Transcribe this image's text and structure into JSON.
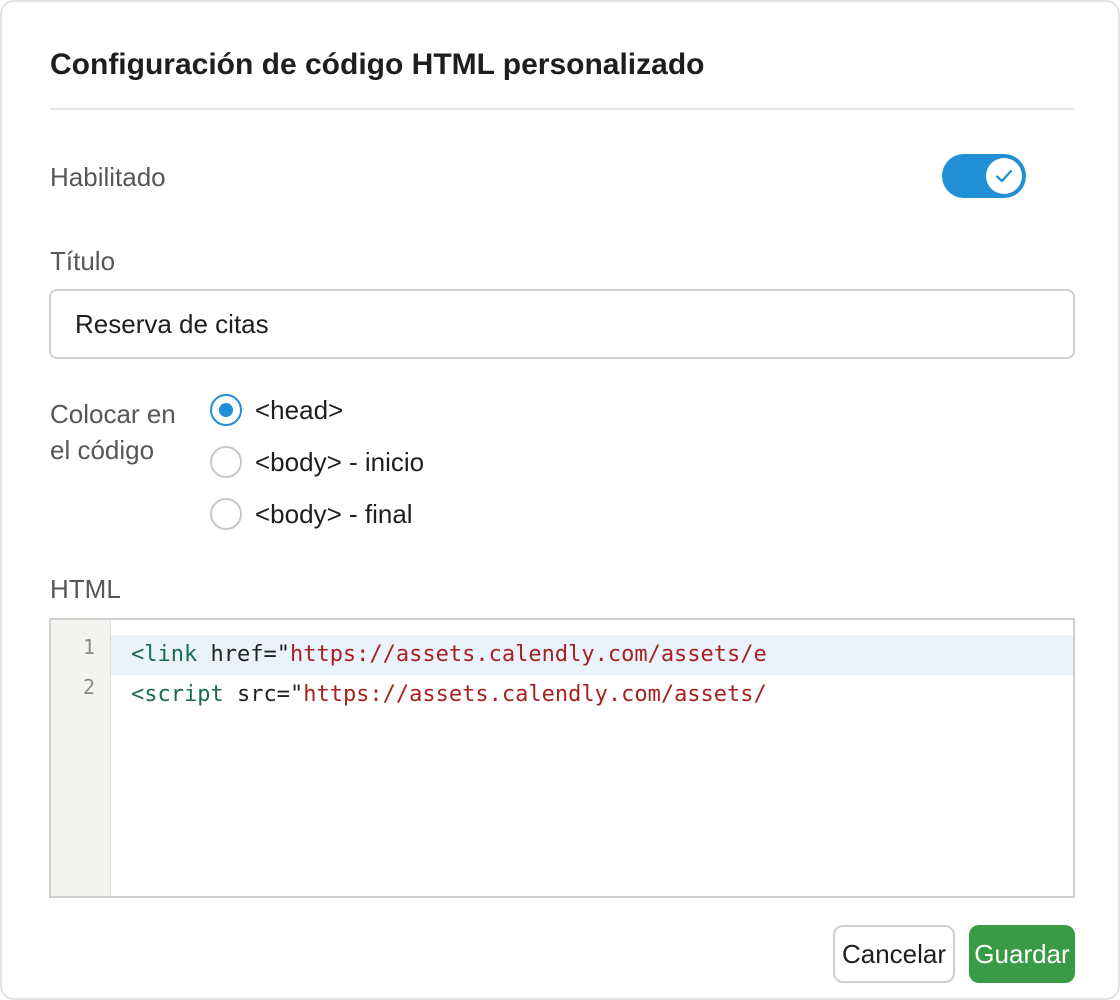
{
  "dialog": {
    "title": "Configuración de código HTML personalizado"
  },
  "enabled": {
    "label": "Habilitado",
    "value": true
  },
  "title_field": {
    "label": "Título",
    "value": "Reserva de citas"
  },
  "placement": {
    "label_line1": "Colocar en",
    "label_line2": "el código",
    "options": [
      {
        "label": "<head>",
        "checked": true
      },
      {
        "label": "<body> - inicio",
        "checked": false
      },
      {
        "label": "<body> - final",
        "checked": false
      }
    ]
  },
  "html_editor": {
    "label": "HTML",
    "lines": [
      {
        "number": "1",
        "tag": "<link",
        "attr": " href=\"",
        "value": "https://assets.calendly.com/assets/e"
      },
      {
        "number": "2",
        "tag": "<script",
        "attr": " src=\"",
        "value": "https://assets.calendly.com/assets/"
      }
    ]
  },
  "actions": {
    "cancel_label": "Cancelar",
    "save_label": "Guardar"
  },
  "colors": {
    "accent": "#1f8fd6",
    "save_button": "#3a9b47"
  },
  "icons": {
    "toggle": "check-icon"
  }
}
